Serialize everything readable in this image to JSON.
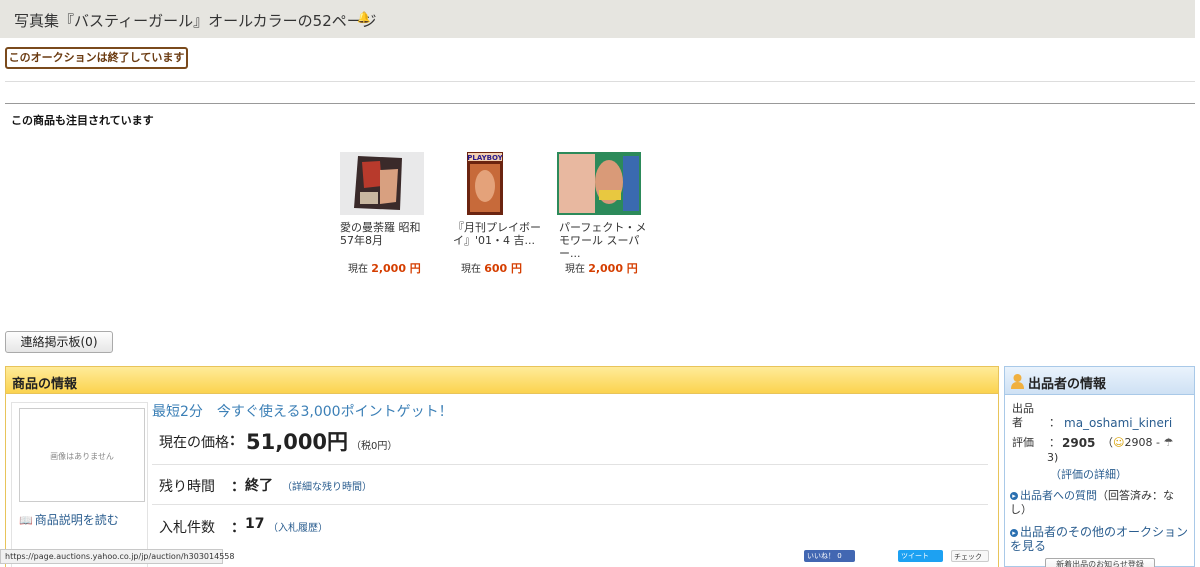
{
  "header": {
    "title": "写真集『バスティーガール』オールカラーの52ページ",
    "title_icon": "bell-icon"
  },
  "auction": {
    "ended_label": "このオークションは終了しています"
  },
  "attention": {
    "title": "この商品も注目されています",
    "items": [
      {
        "name": "愛の曼荼羅 昭和57年8月",
        "price_label": "現在",
        "price": "2,000 円"
      },
      {
        "name": "『月刊プレイボーイ』'01・4 吉...",
        "price_label": "現在",
        "price": "600 円"
      },
      {
        "name": "パーフェクト・メモワール スーパー...",
        "price_label": "現在",
        "price": "2,000 円"
      }
    ]
  },
  "board": {
    "label": "連絡掲示板(0)"
  },
  "item_info": {
    "heading": "商品の情報",
    "no_image": "画像はありません",
    "read_description": "商品説明を読む",
    "promo": "最短2分　今すぐ使える3,000ポイントゲット！",
    "current_price_label": "現在の価格",
    "current_price_colon": "：",
    "current_price": "51,000円",
    "tax_note": "（税0円）",
    "remaining_label": "残り時間",
    "colon": "：",
    "remaining_value": "終了",
    "remaining_detail": "（詳細な残り時間）",
    "bids_label": "入札件数",
    "bids_value": "17",
    "bids_history": "（入札履歴）"
  },
  "seller": {
    "heading": "出品者の情報",
    "seller_label": "出品者",
    "colon": "：",
    "seller_name": "ma_oshami_kineri",
    "rating_label": "評価",
    "rating_value": "2905",
    "rating_breakdown_open": "（",
    "rating_good": "2908",
    "rating_sep": " - ",
    "rating_bad": "3)",
    "rating_detail": "（評価の詳細）",
    "questions_link": "出品者への質問",
    "questions_note": "（回答済み：なし）",
    "other_auctions_link": "出品者のその他のオークションを見る",
    "new_listing_btn": "新着出品のお知らせ登録"
  },
  "social": {
    "like": "いいね！ 0",
    "tweet": "ツイート",
    "check": "チェック"
  },
  "statusbar": {
    "url": "https://page.auctions.yahoo.co.jp/jp/auction/h303014558"
  },
  "colors": {
    "price_accent": "#d53e00",
    "link": "#2a5d8f",
    "item_header": "#fbd34f",
    "seller_header": "#cfe1f4"
  }
}
